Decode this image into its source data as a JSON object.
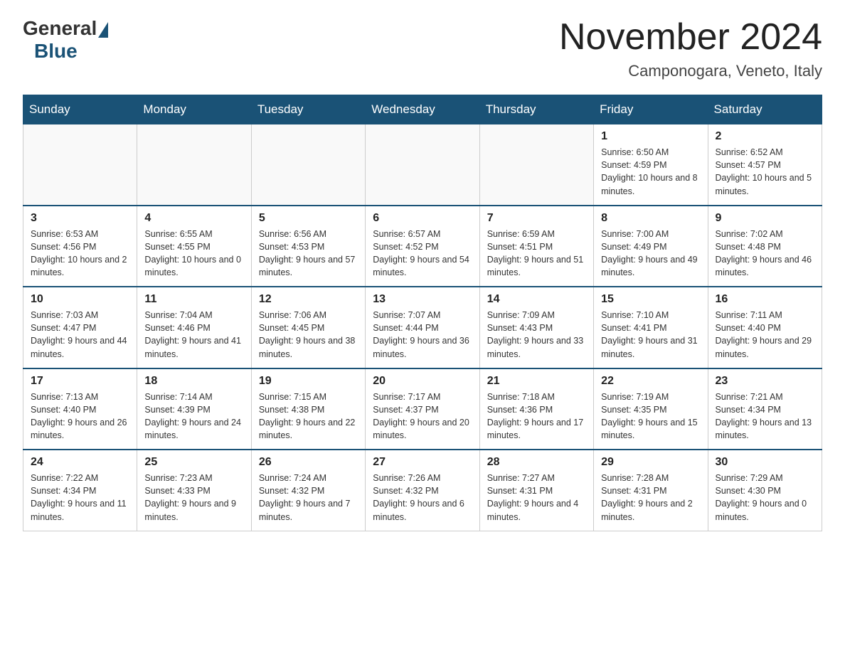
{
  "logo": {
    "general": "General",
    "blue": "Blue"
  },
  "title": {
    "month_year": "November 2024",
    "location": "Camponogara, Veneto, Italy"
  },
  "weekdays": [
    "Sunday",
    "Monday",
    "Tuesday",
    "Wednesday",
    "Thursday",
    "Friday",
    "Saturday"
  ],
  "weeks": [
    [
      {
        "day": "",
        "sunrise": "",
        "sunset": "",
        "daylight": "",
        "empty": true
      },
      {
        "day": "",
        "sunrise": "",
        "sunset": "",
        "daylight": "",
        "empty": true
      },
      {
        "day": "",
        "sunrise": "",
        "sunset": "",
        "daylight": "",
        "empty": true
      },
      {
        "day": "",
        "sunrise": "",
        "sunset": "",
        "daylight": "",
        "empty": true
      },
      {
        "day": "",
        "sunrise": "",
        "sunset": "",
        "daylight": "",
        "empty": true
      },
      {
        "day": "1",
        "sunrise": "Sunrise: 6:50 AM",
        "sunset": "Sunset: 4:59 PM",
        "daylight": "Daylight: 10 hours and 8 minutes.",
        "empty": false
      },
      {
        "day": "2",
        "sunrise": "Sunrise: 6:52 AM",
        "sunset": "Sunset: 4:57 PM",
        "daylight": "Daylight: 10 hours and 5 minutes.",
        "empty": false
      }
    ],
    [
      {
        "day": "3",
        "sunrise": "Sunrise: 6:53 AM",
        "sunset": "Sunset: 4:56 PM",
        "daylight": "Daylight: 10 hours and 2 minutes.",
        "empty": false
      },
      {
        "day": "4",
        "sunrise": "Sunrise: 6:55 AM",
        "sunset": "Sunset: 4:55 PM",
        "daylight": "Daylight: 10 hours and 0 minutes.",
        "empty": false
      },
      {
        "day": "5",
        "sunrise": "Sunrise: 6:56 AM",
        "sunset": "Sunset: 4:53 PM",
        "daylight": "Daylight: 9 hours and 57 minutes.",
        "empty": false
      },
      {
        "day": "6",
        "sunrise": "Sunrise: 6:57 AM",
        "sunset": "Sunset: 4:52 PM",
        "daylight": "Daylight: 9 hours and 54 minutes.",
        "empty": false
      },
      {
        "day": "7",
        "sunrise": "Sunrise: 6:59 AM",
        "sunset": "Sunset: 4:51 PM",
        "daylight": "Daylight: 9 hours and 51 minutes.",
        "empty": false
      },
      {
        "day": "8",
        "sunrise": "Sunrise: 7:00 AM",
        "sunset": "Sunset: 4:49 PM",
        "daylight": "Daylight: 9 hours and 49 minutes.",
        "empty": false
      },
      {
        "day": "9",
        "sunrise": "Sunrise: 7:02 AM",
        "sunset": "Sunset: 4:48 PM",
        "daylight": "Daylight: 9 hours and 46 minutes.",
        "empty": false
      }
    ],
    [
      {
        "day": "10",
        "sunrise": "Sunrise: 7:03 AM",
        "sunset": "Sunset: 4:47 PM",
        "daylight": "Daylight: 9 hours and 44 minutes.",
        "empty": false
      },
      {
        "day": "11",
        "sunrise": "Sunrise: 7:04 AM",
        "sunset": "Sunset: 4:46 PM",
        "daylight": "Daylight: 9 hours and 41 minutes.",
        "empty": false
      },
      {
        "day": "12",
        "sunrise": "Sunrise: 7:06 AM",
        "sunset": "Sunset: 4:45 PM",
        "daylight": "Daylight: 9 hours and 38 minutes.",
        "empty": false
      },
      {
        "day": "13",
        "sunrise": "Sunrise: 7:07 AM",
        "sunset": "Sunset: 4:44 PM",
        "daylight": "Daylight: 9 hours and 36 minutes.",
        "empty": false
      },
      {
        "day": "14",
        "sunrise": "Sunrise: 7:09 AM",
        "sunset": "Sunset: 4:43 PM",
        "daylight": "Daylight: 9 hours and 33 minutes.",
        "empty": false
      },
      {
        "day": "15",
        "sunrise": "Sunrise: 7:10 AM",
        "sunset": "Sunset: 4:41 PM",
        "daylight": "Daylight: 9 hours and 31 minutes.",
        "empty": false
      },
      {
        "day": "16",
        "sunrise": "Sunrise: 7:11 AM",
        "sunset": "Sunset: 4:40 PM",
        "daylight": "Daylight: 9 hours and 29 minutes.",
        "empty": false
      }
    ],
    [
      {
        "day": "17",
        "sunrise": "Sunrise: 7:13 AM",
        "sunset": "Sunset: 4:40 PM",
        "daylight": "Daylight: 9 hours and 26 minutes.",
        "empty": false
      },
      {
        "day": "18",
        "sunrise": "Sunrise: 7:14 AM",
        "sunset": "Sunset: 4:39 PM",
        "daylight": "Daylight: 9 hours and 24 minutes.",
        "empty": false
      },
      {
        "day": "19",
        "sunrise": "Sunrise: 7:15 AM",
        "sunset": "Sunset: 4:38 PM",
        "daylight": "Daylight: 9 hours and 22 minutes.",
        "empty": false
      },
      {
        "day": "20",
        "sunrise": "Sunrise: 7:17 AM",
        "sunset": "Sunset: 4:37 PM",
        "daylight": "Daylight: 9 hours and 20 minutes.",
        "empty": false
      },
      {
        "day": "21",
        "sunrise": "Sunrise: 7:18 AM",
        "sunset": "Sunset: 4:36 PM",
        "daylight": "Daylight: 9 hours and 17 minutes.",
        "empty": false
      },
      {
        "day": "22",
        "sunrise": "Sunrise: 7:19 AM",
        "sunset": "Sunset: 4:35 PM",
        "daylight": "Daylight: 9 hours and 15 minutes.",
        "empty": false
      },
      {
        "day": "23",
        "sunrise": "Sunrise: 7:21 AM",
        "sunset": "Sunset: 4:34 PM",
        "daylight": "Daylight: 9 hours and 13 minutes.",
        "empty": false
      }
    ],
    [
      {
        "day": "24",
        "sunrise": "Sunrise: 7:22 AM",
        "sunset": "Sunset: 4:34 PM",
        "daylight": "Daylight: 9 hours and 11 minutes.",
        "empty": false
      },
      {
        "day": "25",
        "sunrise": "Sunrise: 7:23 AM",
        "sunset": "Sunset: 4:33 PM",
        "daylight": "Daylight: 9 hours and 9 minutes.",
        "empty": false
      },
      {
        "day": "26",
        "sunrise": "Sunrise: 7:24 AM",
        "sunset": "Sunset: 4:32 PM",
        "daylight": "Daylight: 9 hours and 7 minutes.",
        "empty": false
      },
      {
        "day": "27",
        "sunrise": "Sunrise: 7:26 AM",
        "sunset": "Sunset: 4:32 PM",
        "daylight": "Daylight: 9 hours and 6 minutes.",
        "empty": false
      },
      {
        "day": "28",
        "sunrise": "Sunrise: 7:27 AM",
        "sunset": "Sunset: 4:31 PM",
        "daylight": "Daylight: 9 hours and 4 minutes.",
        "empty": false
      },
      {
        "day": "29",
        "sunrise": "Sunrise: 7:28 AM",
        "sunset": "Sunset: 4:31 PM",
        "daylight": "Daylight: 9 hours and 2 minutes.",
        "empty": false
      },
      {
        "day": "30",
        "sunrise": "Sunrise: 7:29 AM",
        "sunset": "Sunset: 4:30 PM",
        "daylight": "Daylight: 9 hours and 0 minutes.",
        "empty": false
      }
    ]
  ]
}
